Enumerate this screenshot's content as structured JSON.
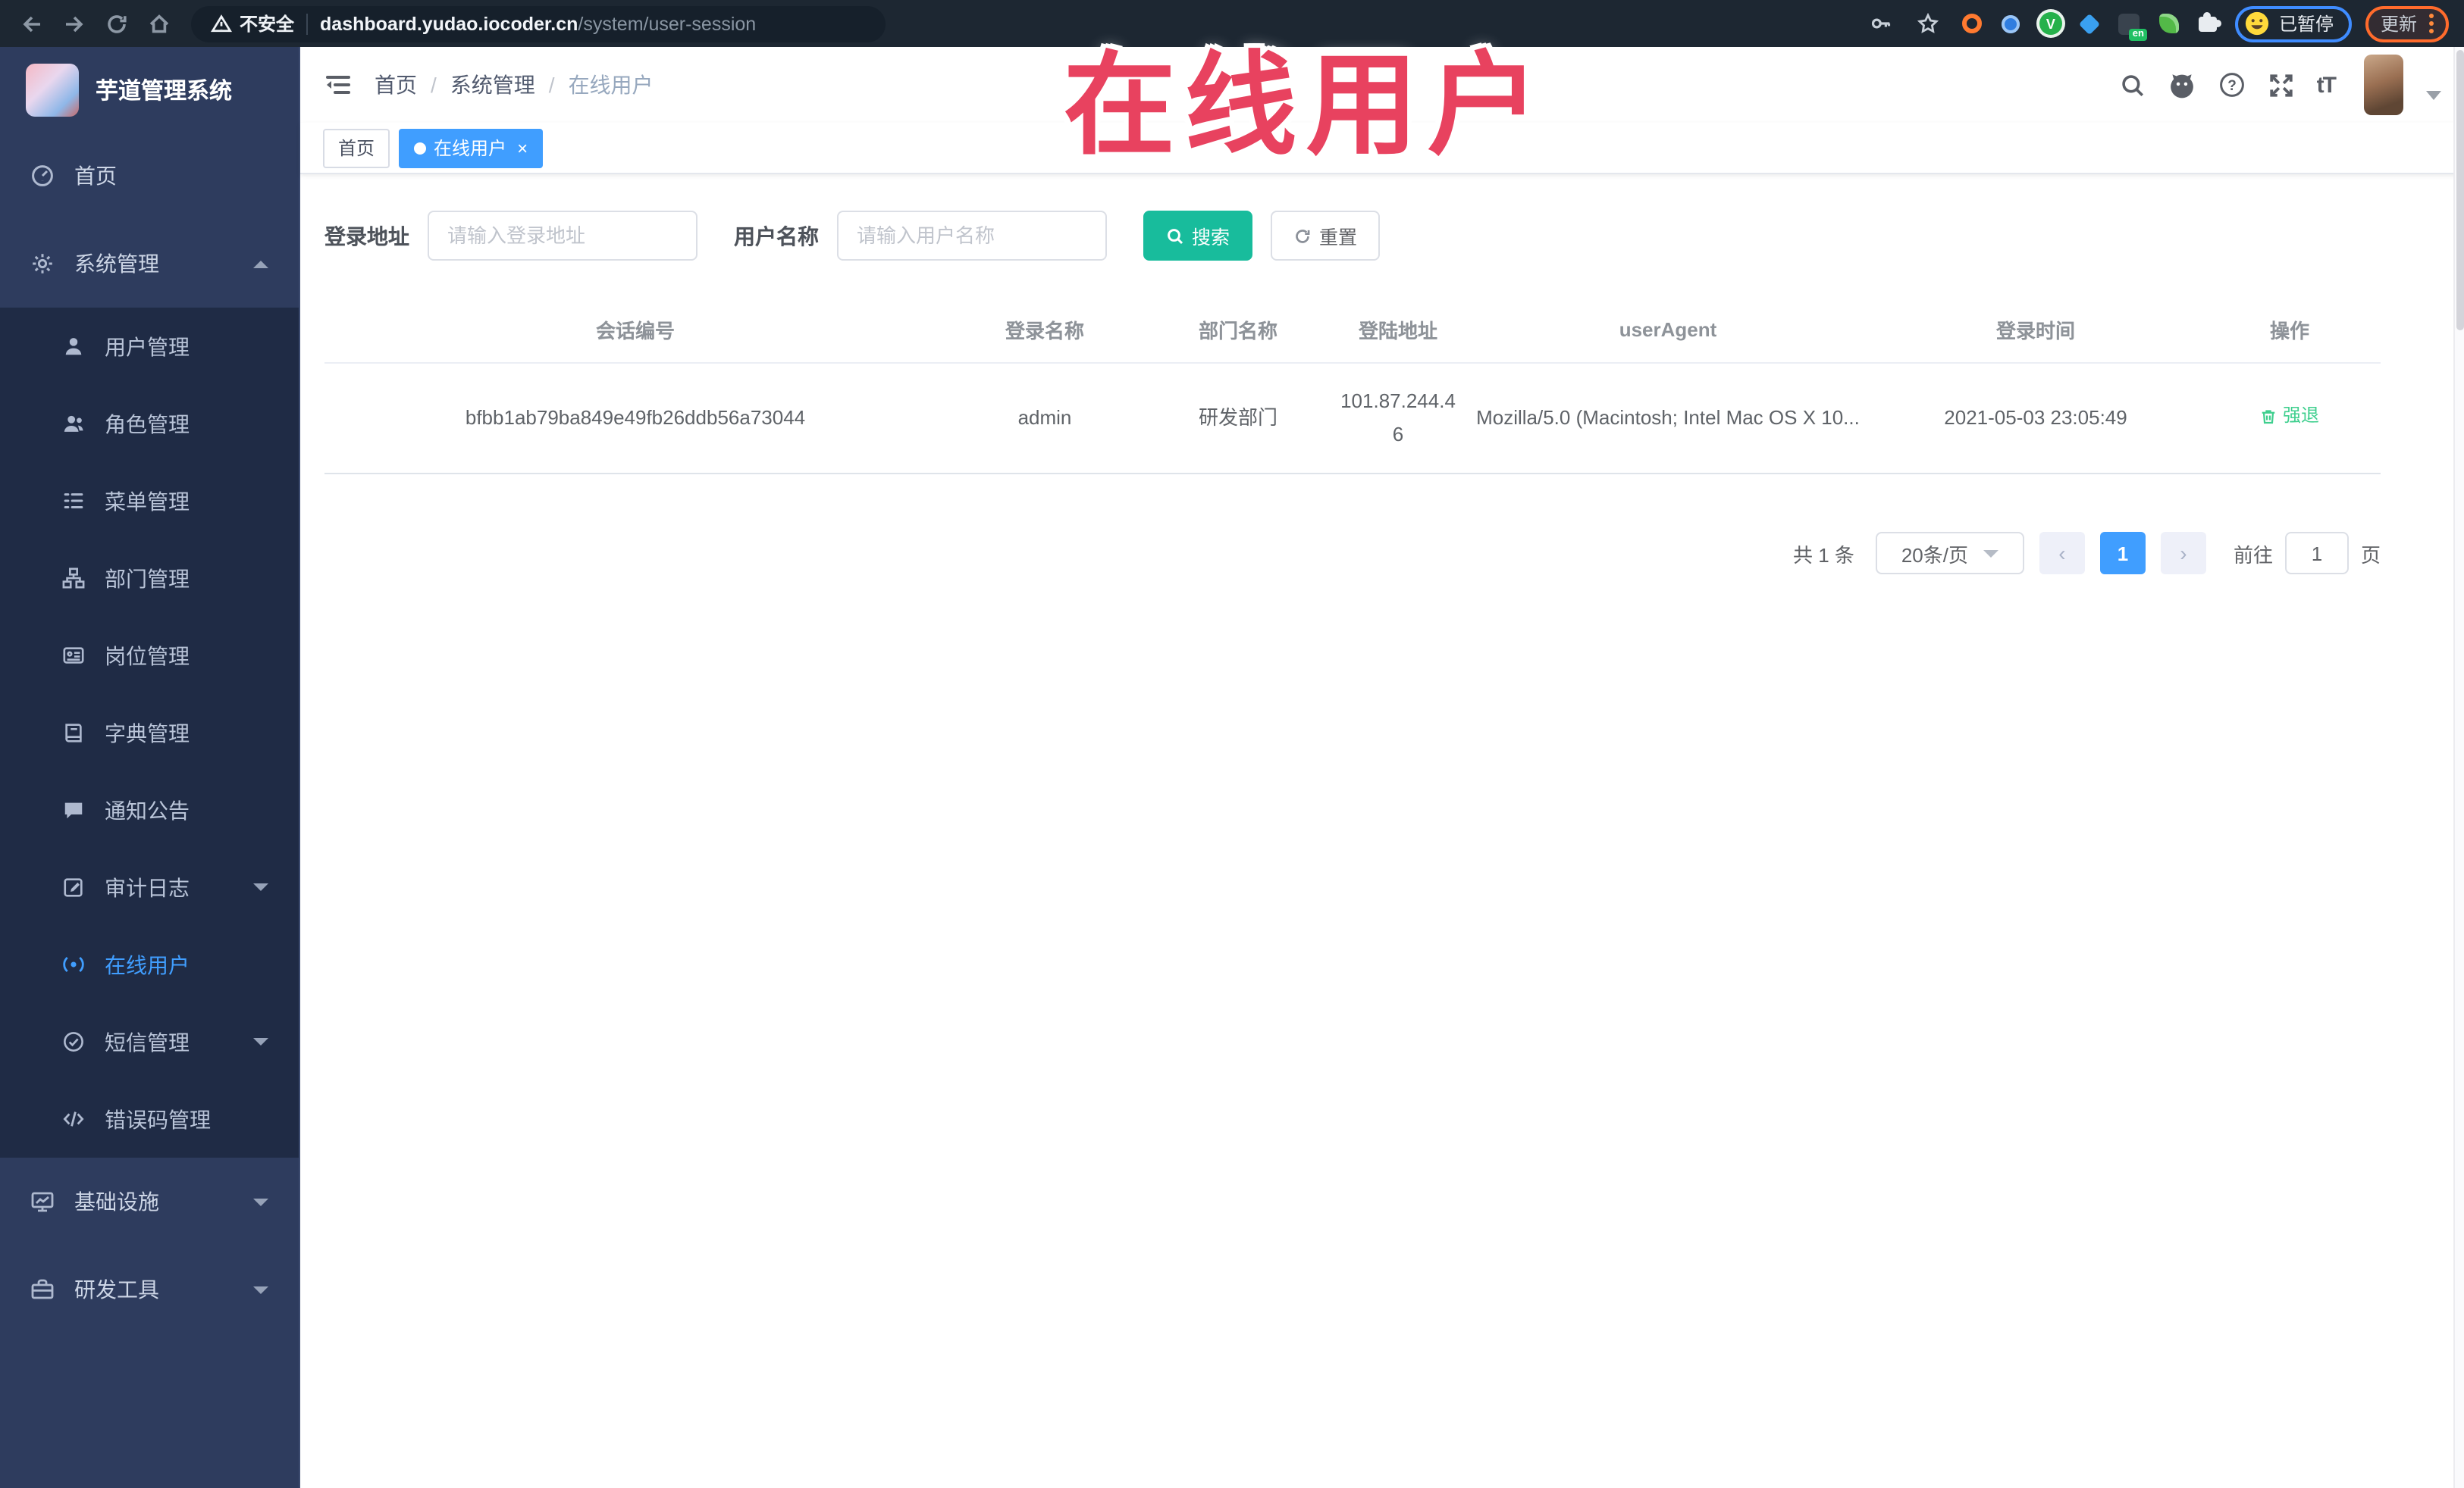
{
  "colors": {
    "accent_blue": "#409eff",
    "sidebar_bg": "#2e3c5e",
    "submenu_bg": "#1f2b45",
    "search_button": "#18bc9c",
    "action_green": "#3fcf8e",
    "annotation_red": "#e8425f",
    "chrome_bg": "#1d2732",
    "update_border": "#ff6b2c",
    "paused_border": "#3f8cff"
  },
  "annotation": {
    "text": "在线用户"
  },
  "browser": {
    "security_label": "不安全",
    "url_domain": "dashboard.yudao.iocoder.cn",
    "url_path": "/system/user-session",
    "translate_badge": "en",
    "paused_label": "已暂停",
    "update_label": "更新"
  },
  "sidebar": {
    "title": "芋道管理系统",
    "menu": [
      {
        "label": "首页",
        "icon": "dashboard-icon"
      },
      {
        "label": "系统管理",
        "icon": "gear-icon",
        "state": "expanded"
      }
    ],
    "submenu": [
      {
        "label": "用户管理",
        "icon": "user-icon"
      },
      {
        "label": "角色管理",
        "icon": "role-icon"
      },
      {
        "label": "菜单管理",
        "icon": "menu-list-icon"
      },
      {
        "label": "部门管理",
        "icon": "org-tree-icon"
      },
      {
        "label": "岗位管理",
        "icon": "id-card-icon"
      },
      {
        "label": "字典管理",
        "icon": "dict-book-icon"
      },
      {
        "label": "通知公告",
        "icon": "announcement-icon"
      },
      {
        "label": "审计日志",
        "icon": "audit-log-icon",
        "state": "collapsed"
      },
      {
        "label": "在线用户",
        "icon": "online-user-icon",
        "active": true
      },
      {
        "label": "短信管理",
        "icon": "sms-icon",
        "state": "collapsed"
      },
      {
        "label": "错误码管理",
        "icon": "code-icon"
      }
    ],
    "bottom": [
      {
        "label": "基础设施",
        "icon": "infra-monitor-icon",
        "state": "collapsed"
      },
      {
        "label": "研发工具",
        "icon": "dev-tools-icon",
        "state": "collapsed"
      }
    ]
  },
  "navbar": {
    "breadcrumb": [
      "首页",
      "系统管理",
      "在线用户"
    ],
    "separator": "/"
  },
  "tags": [
    {
      "label": "首页",
      "active": false
    },
    {
      "label": "在线用户",
      "active": true,
      "close": "×"
    }
  ],
  "filters": {
    "login_address_label": "登录地址",
    "login_address_placeholder": "请输入登录地址",
    "username_label": "用户名称",
    "username_placeholder": "请输入用户名称",
    "search_label": "搜索",
    "reset_label": "重置"
  },
  "table": {
    "columns": [
      "会话编号",
      "登录名称",
      "部门名称",
      "登陆地址",
      "userAgent",
      "登录时间",
      "操作"
    ],
    "row": {
      "session_id": "bfbb1ab79ba849e49fb26ddb56a73044",
      "login_name": "admin",
      "dept_name": "研发部门",
      "login_ip": "101.87.244.46",
      "user_agent": "Mozilla/5.0 (Macintosh; Intel Mac OS X 10...",
      "login_time": "2021-05-03 23:05:49",
      "action_label": "强退"
    }
  },
  "pagination": {
    "total_label": "共 1 条",
    "page_size_label": "20条/页",
    "prev_glyph": "‹",
    "next_glyph": "›",
    "current_page": "1",
    "goto_label": "前往",
    "goto_value": "1",
    "unit_label": "页"
  }
}
